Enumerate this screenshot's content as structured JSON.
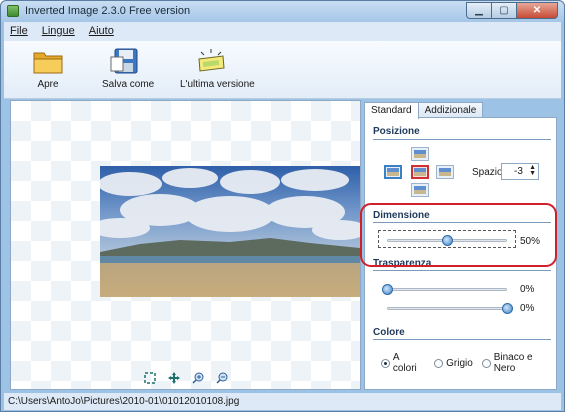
{
  "window": {
    "title": "Inverted Image 2.3.0 Free version"
  },
  "menu": {
    "items": [
      "File",
      "Lingue",
      "Aiuto"
    ]
  },
  "toolbar": {
    "buttons": [
      {
        "label": "Apre",
        "icon": "folder-icon"
      },
      {
        "label": "Salva come",
        "icon": "save-icon"
      },
      {
        "label": "L'ultima versione",
        "icon": "update-icon"
      }
    ]
  },
  "tabs": [
    {
      "label": "Standard",
      "active": true
    },
    {
      "label": "Addizionale",
      "active": false
    }
  ],
  "posizione": {
    "title": "Posizione",
    "spazio_label": "Spazio",
    "spazio_value": "-3",
    "selected": "center-right"
  },
  "dimensione": {
    "title": "Dimensione",
    "value": "50%",
    "level": 0.5
  },
  "trasparenza": {
    "title": "Trasparenza",
    "value1": "0%",
    "level1": 0.0,
    "value2": "0%",
    "level2": 1.0
  },
  "colore": {
    "title": "Colore",
    "options": [
      {
        "label": "A colori",
        "selected": true
      },
      {
        "label": "Grigio",
        "selected": false
      },
      {
        "label": "Binaco e Nero",
        "selected": false
      }
    ]
  },
  "status": {
    "path": "C:\\Users\\AntoJo\\Pictures\\2010-01\\01012010108.jpg"
  },
  "colors": {
    "highlight": "#d0202a",
    "accent": "#3b7fc4",
    "titlebar": "#a5c6e8"
  }
}
